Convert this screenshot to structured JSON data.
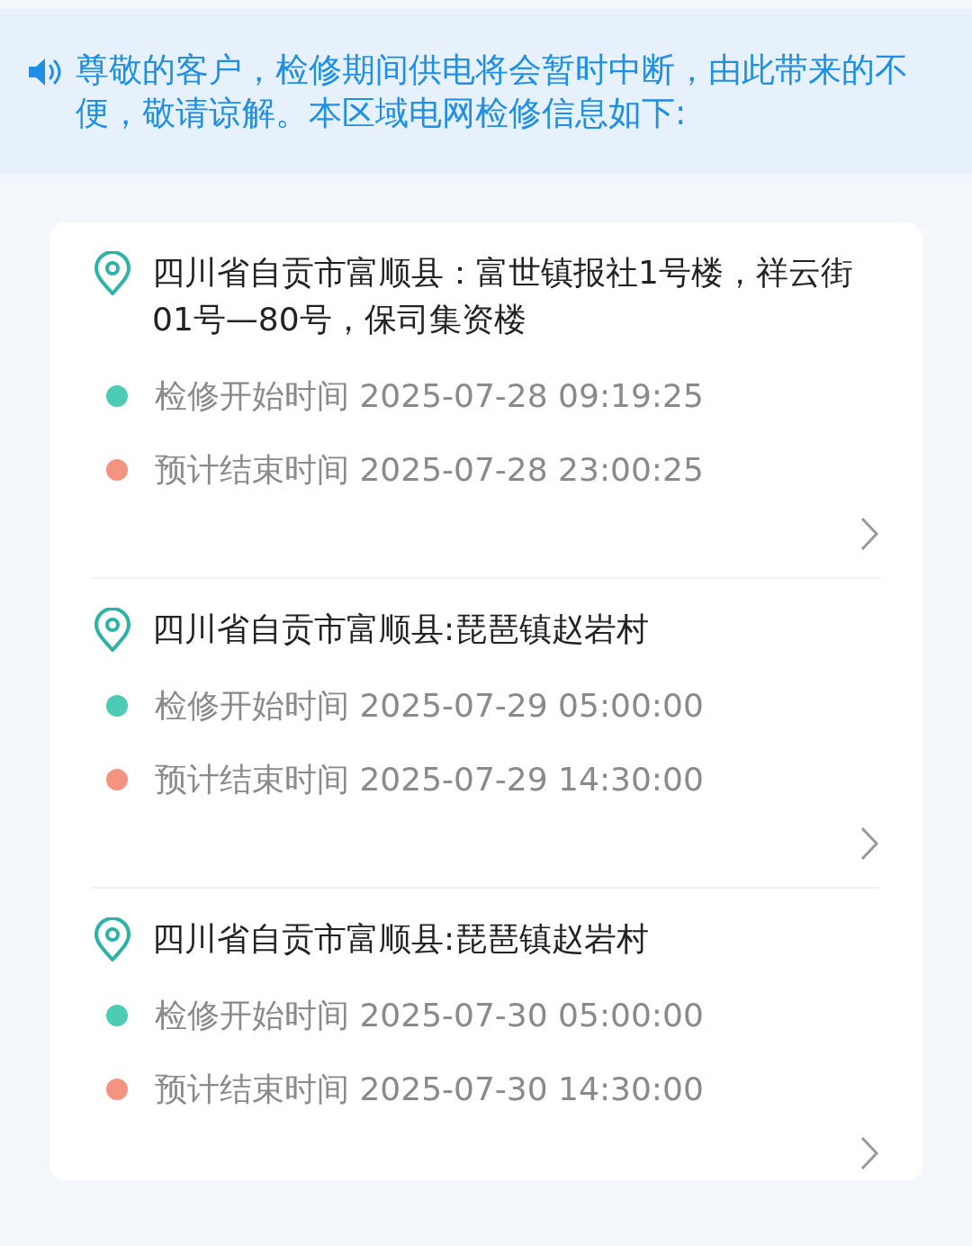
{
  "notice": {
    "text": "尊敬的客户，检修期间供电将会暂时中断，由此带来的不便，敬请谅解。本区域电网检修信息如下:"
  },
  "outages": [
    {
      "address": "四川省自贡市富顺县：富世镇报社1号楼，祥云街01号—80号，保司集资楼",
      "times": [
        {
          "text": "检修开始时间 2025-07-28 09:19:25",
          "color": "#4ecbb4"
        },
        {
          "text": "预计结束时间 2025-07-28 23:00:25",
          "color": "#f39380"
        }
      ]
    },
    {
      "address": "四川省自贡市富顺县:琵琶镇赵岩村",
      "times": [
        {
          "text": "检修开始时间 2025-07-29 05:00:00",
          "color": "#4ecbb4"
        },
        {
          "text": "预计结束时间 2025-07-29 14:30:00",
          "color": "#f39380"
        }
      ]
    },
    {
      "address": "四川省自贡市富顺县:琵琶镇赵岩村",
      "times": [
        {
          "text": "检修开始时间 2025-07-30 05:00:00",
          "color": "#4ecbb4"
        },
        {
          "text": "预计结束时间 2025-07-30 14:30:00",
          "color": "#f39380"
        }
      ]
    }
  ]
}
